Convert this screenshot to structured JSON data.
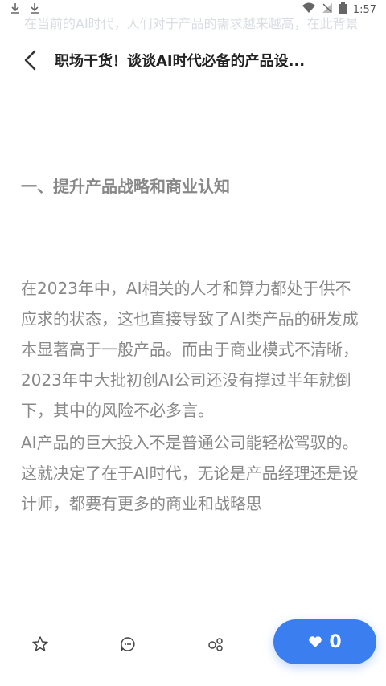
{
  "status": {
    "time": "1:57"
  },
  "header": {
    "title": "职场干货！谈谈AI时代必备的产品设...",
    "faint_top_text": "在当前的AI时代，人们对于产品的需求越来越高，在此背景"
  },
  "article": {
    "heading": "一、提升产品战略和商业认知",
    "paragraphs": [
      "在2023年中，AI相关的人才和算力都处于供不应求的状态，这也直接导致了AI类产品的研发成本显著高于一般产品。而由于商业模式不清晰，2023年中大批初创AI公司还没有撑过半年就倒下，其中的风险不必多言。",
      "AI产品的巨大投入不是普通公司能轻松驾驭的。这就决定了在于AI时代，无论是产品经理还是设计师，都要有更多的商业和战略思"
    ]
  },
  "bottom": {
    "like_count": "0"
  },
  "colors": {
    "accent": "#3b7ef0"
  }
}
